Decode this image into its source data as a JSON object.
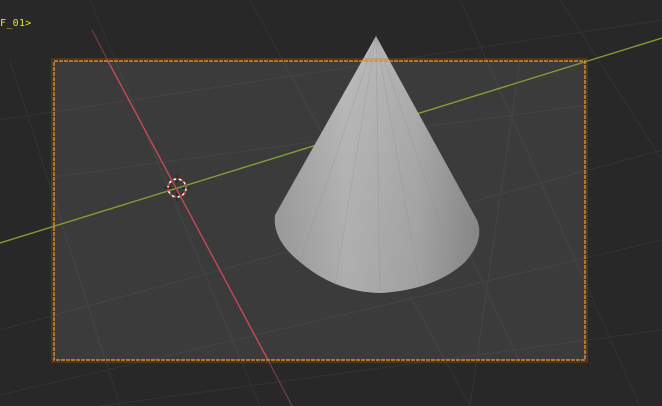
{
  "viewport": {
    "object_label": "F_01>"
  },
  "colors": {
    "background": "#282828",
    "camera_frame_fill": "#3b3b3b",
    "camera_frame_border": "#e08a2a",
    "x_axis": "#c44a55",
    "y_axis": "#7fa032",
    "grid": "#353535",
    "label": "#e5e52f"
  },
  "icons": {
    "origin": "3d-cursor-icon",
    "object": "cone-mesh"
  }
}
